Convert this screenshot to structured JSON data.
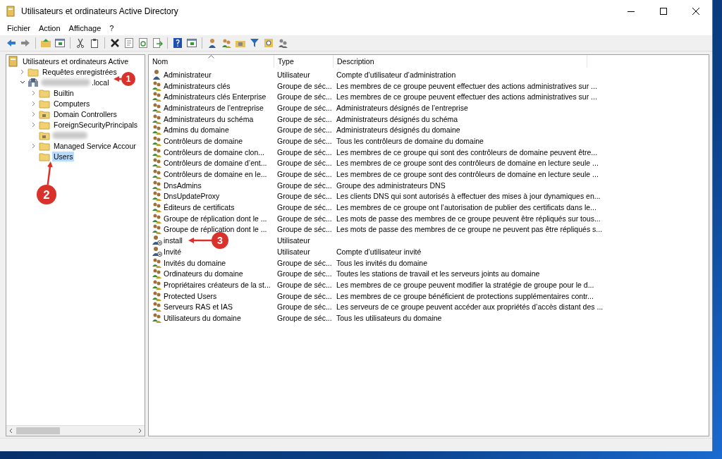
{
  "window": {
    "title": "Utilisateurs et ordinateurs Active Directory"
  },
  "menu": [
    "Fichier",
    "Action",
    "Affichage",
    "?"
  ],
  "tree": {
    "label": "Utilisateurs et ordinateurs Active",
    "kind": "console",
    "children": [
      {
        "label": "Requêtes enregistrées",
        "kind": "folder",
        "expanded": false,
        "selected": false
      },
      {
        "label": ".local",
        "kind": "domain",
        "redacted": true,
        "expanded": true,
        "selected": false,
        "children": [
          {
            "label": "Builtin",
            "kind": "folder",
            "expanded": false,
            "selected": false
          },
          {
            "label": "Computers",
            "kind": "folder",
            "expanded": false,
            "selected": false
          },
          {
            "label": "Domain Controllers",
            "kind": "ou",
            "expanded": false,
            "selected": false
          },
          {
            "label": "ForeignSecurityPrincipals",
            "kind": "folder",
            "expanded": false,
            "selected": false
          },
          {
            "kind": "ou",
            "redacted": true
          },
          {
            "label": "Managed Service Accour",
            "kind": "folder",
            "expanded": false,
            "selected": false
          },
          {
            "label": "Users",
            "kind": "folder",
            "selected": true
          }
        ]
      }
    ]
  },
  "table": {
    "columns": [
      "Nom",
      "Type",
      "Description"
    ],
    "rows": [
      {
        "kind": "admin",
        "name": "Administrateur",
        "type": "Utilisateur",
        "description": "Compte d’utilisateur d’administration"
      },
      {
        "kind": "group",
        "name": "Administrateurs clés",
        "type": "Groupe de séc...",
        "description": "Les membres de ce groupe peuvent effectuer des actions administratives sur ..."
      },
      {
        "kind": "group",
        "name": "Administrateurs clés Enterprise",
        "type": "Groupe de séc...",
        "description": "Les membres de ce groupe peuvent effectuer des actions administratives sur ..."
      },
      {
        "kind": "group",
        "name": "Administrateurs de l’entreprise",
        "type": "Groupe de séc...",
        "description": "Administrateurs désignés de l’entreprise"
      },
      {
        "kind": "group",
        "name": "Administrateurs du schéma",
        "type": "Groupe de séc...",
        "description": "Administrateurs désignés du schéma"
      },
      {
        "kind": "group",
        "name": "Admins du domaine",
        "type": "Groupe de séc...",
        "description": "Administrateurs désignés du domaine"
      },
      {
        "kind": "group",
        "name": "Contrôleurs de domaine",
        "type": "Groupe de séc...",
        "description": "Tous les contrôleurs de domaine du domaine"
      },
      {
        "kind": "group",
        "name": "Contrôleurs de domaine clon...",
        "type": "Groupe de séc...",
        "description": "Les membres de ce groupe qui sont des contrôleurs de domaine peuvent être..."
      },
      {
        "kind": "group",
        "name": "Contrôleurs de domaine d’ent...",
        "type": "Groupe de séc...",
        "description": "Les membres de ce groupe sont des contrôleurs de domaine en lecture seule ..."
      },
      {
        "kind": "group",
        "name": "Contrôleurs de domaine en le...",
        "type": "Groupe de séc...",
        "description": "Les membres de ce groupe sont des contrôleurs de domaine en lecture seule ..."
      },
      {
        "kind": "group",
        "name": "DnsAdmins",
        "type": "Groupe de séc...",
        "description": "Groupe des administrateurs DNS"
      },
      {
        "kind": "group",
        "name": "DnsUpdateProxy",
        "type": "Groupe de séc...",
        "description": "Les clients DNS qui sont autorisés à effectuer des mises à jour dynamiques en..."
      },
      {
        "kind": "group",
        "name": "Éditeurs de certificats",
        "type": "Groupe de séc...",
        "description": "Les membres de ce groupe ont l’autorisation de publier des certificats dans le..."
      },
      {
        "kind": "group",
        "name": "Groupe de réplication dont le ...",
        "type": "Groupe de séc...",
        "description": "Les mots de passe des membres de ce groupe peuvent être répliqués sur tous..."
      },
      {
        "kind": "group",
        "name": "Groupe de réplication dont le ...",
        "type": "Groupe de séc...",
        "description": "Les mots de passe des membres de ce groupe ne peuvent pas être répliqués s..."
      },
      {
        "kind": "disabled-user",
        "name": "install",
        "type": "Utilisateur"
      },
      {
        "kind": "disabled-user",
        "name": "Invité",
        "type": "Utilisateur",
        "description": "Compte d’utilisateur invité"
      },
      {
        "kind": "group",
        "name": "Invités du domaine",
        "type": "Groupe de séc...",
        "description": "Tous les invités du domaine"
      },
      {
        "kind": "group",
        "name": "Ordinateurs du domaine",
        "type": "Groupe de séc...",
        "description": "Toutes les stations de travail et les serveurs joints au domaine"
      },
      {
        "kind": "group",
        "name": "Propriétaires créateurs de la st...",
        "type": "Groupe de séc...",
        "description": "Les membres de ce groupe peuvent modifier la stratégie de groupe pour le d..."
      },
      {
        "kind": "group",
        "name": "Protected Users",
        "type": "Groupe de séc...",
        "description": "Les membres de ce groupe bénéficient de protections supplémentaires contr..."
      },
      {
        "kind": "group",
        "name": "Serveurs RAS et IAS",
        "type": "Groupe de séc...",
        "description": "Les serveurs de ce groupe peuvent accéder aux propriétés d’accès distant des ..."
      },
      {
        "kind": "group",
        "name": "Utilisateurs du domaine",
        "type": "Groupe de séc...",
        "description": "Tous les utilisateurs du domaine"
      }
    ]
  },
  "callouts": [
    {
      "number": "1"
    },
    {
      "number": "2"
    },
    {
      "number": "3"
    }
  ]
}
